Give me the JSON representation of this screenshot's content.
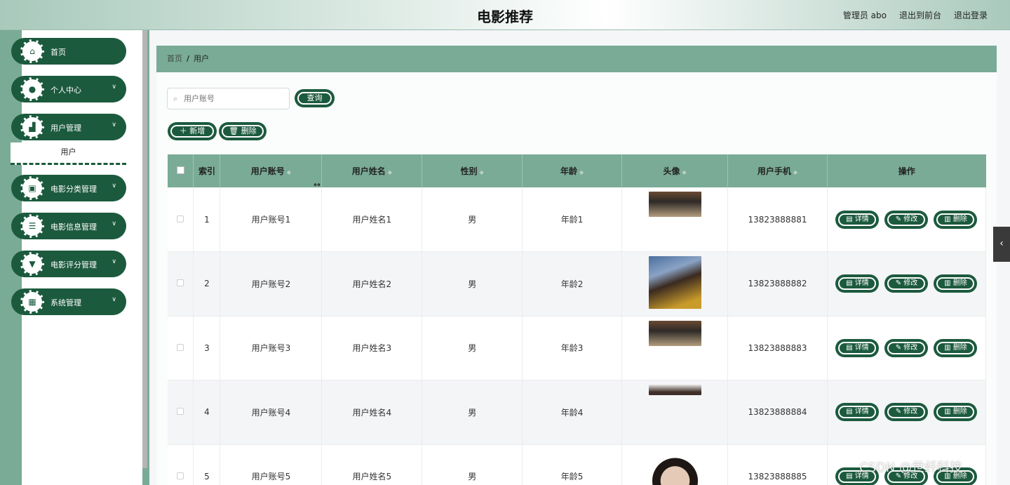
{
  "header": {
    "title": "电影推荐",
    "admin_label": "管理员 abo",
    "front_link": "退出到前台",
    "logout_link": "退出登录"
  },
  "sidebar": {
    "items": [
      {
        "label": "首页",
        "icon": "home-icon",
        "expandable": false
      },
      {
        "label": "个人中心",
        "icon": "user-icon",
        "expandable": true
      },
      {
        "label": "用户管理",
        "icon": "user-manage-icon",
        "expandable": true
      },
      {
        "label": "电影分类管理",
        "icon": "briefcase-icon",
        "expandable": true
      },
      {
        "label": "电影信息管理",
        "icon": "sliders-icon",
        "expandable": true
      },
      {
        "label": "电影评分管理",
        "icon": "trophy-icon",
        "expandable": true
      },
      {
        "label": "系统管理",
        "icon": "grid-icon",
        "expandable": true
      }
    ],
    "submenu_label": "用户"
  },
  "breadcrumb": {
    "home": "首页",
    "separator": "/",
    "current": "用户"
  },
  "search": {
    "placeholder": "用户账号",
    "button": "查询"
  },
  "actions": {
    "add": "新增",
    "delete": "删除"
  },
  "table": {
    "headers": [
      "索引",
      "用户账号",
      "用户姓名",
      "性别",
      "年龄",
      "头像",
      "用户手机",
      "操作"
    ],
    "rows": [
      {
        "index": "1",
        "account": "用户账号1",
        "name": "用户姓名1",
        "gender": "男",
        "age": "年龄1",
        "phone": "13823888881"
      },
      {
        "index": "2",
        "account": "用户账号2",
        "name": "用户姓名2",
        "gender": "男",
        "age": "年龄2",
        "phone": "13823888882"
      },
      {
        "index": "3",
        "account": "用户账号3",
        "name": "用户姓名3",
        "gender": "男",
        "age": "年龄3",
        "phone": "13823888883"
      },
      {
        "index": "4",
        "account": "用户账号4",
        "name": "用户姓名4",
        "gender": "男",
        "age": "年龄4",
        "phone": "13823888884"
      },
      {
        "index": "5",
        "account": "用户账号5",
        "name": "用户姓名5",
        "gender": "男",
        "age": "年龄5",
        "phone": "13823888885"
      }
    ],
    "row_actions": {
      "detail": "详情",
      "edit": "修改",
      "delete": "删除"
    }
  },
  "watermark": "CSDN @世纤科技",
  "colors": {
    "primary": "#1c5a3e",
    "accent": "#7aab97"
  }
}
